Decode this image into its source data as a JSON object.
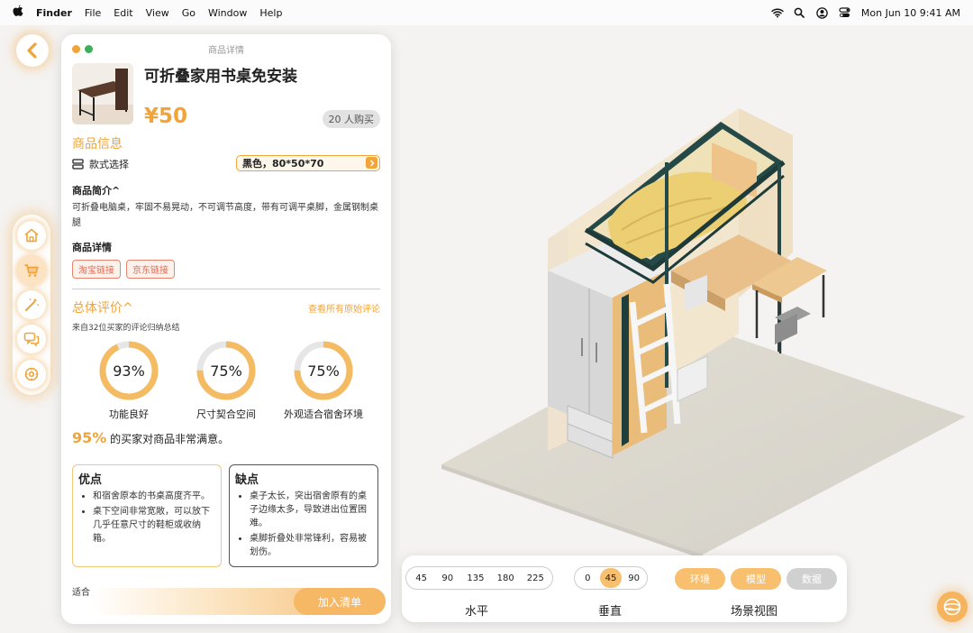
{
  "menubar": {
    "app": "Finder",
    "menus": [
      "File",
      "Edit",
      "View",
      "Go",
      "Window",
      "Help"
    ],
    "datetime": "Mon Jun 10  9:41 AM"
  },
  "panel": {
    "title": "商品详情",
    "product_name": "可折叠家用书桌免安装",
    "price": "¥50",
    "buyers": "20 人购买",
    "info_title": "商品信息",
    "style_label": "款式选择",
    "style_value": "黑色，80*50*70",
    "intro_title": "商品简介^",
    "intro_text": "可折叠电脑桌，牢固不易晃动，不可调节高度，带有可调平桌脚，金属钢制桌腿",
    "detail_title": "商品详情",
    "links": [
      "淘宝链接",
      "京东链接"
    ],
    "review_title": "总体评价^",
    "view_all": "查看所有原始评论",
    "summary_source": "来自32位买家的评论归纳总结",
    "rings": [
      {
        "value": 93,
        "text": "93%",
        "label": "功能良好"
      },
      {
        "value": 75,
        "text": "75%",
        "label": "尺寸契合空间"
      },
      {
        "value": 75,
        "text": "75%",
        "label": "外观适合宿舍环境"
      }
    ],
    "satisfaction_pct": "95%",
    "satisfaction_text": "的买家对商品非常满意。",
    "pros_title": "优点",
    "pros": [
      "和宿舍原本的书桌高度齐平。",
      "桌下空间非常宽敞，可以放下几乎任意尺寸的鞋柜或收纳箱。"
    ],
    "cons_title": "缺点",
    "cons": [
      "桌子太长，突出宿舍原有的桌子边缘太多，导致进出位置困难。",
      "桌脚折叠处非常锋利，容易被划伤。"
    ],
    "partial_label": "适合",
    "add_button": "加入清单"
  },
  "controls": {
    "horizontal": {
      "options": [
        "45",
        "90",
        "135",
        "180",
        "225"
      ],
      "label": "水平"
    },
    "vertical": {
      "options": [
        "0",
        "45",
        "90"
      ],
      "selected": "45",
      "label": "垂直"
    },
    "scene": {
      "options": [
        "环境",
        "模型",
        "数据"
      ],
      "label": "场景视图"
    }
  },
  "colors": {
    "accent": "#f0a43a",
    "accent_light": "#f7bf6e"
  }
}
